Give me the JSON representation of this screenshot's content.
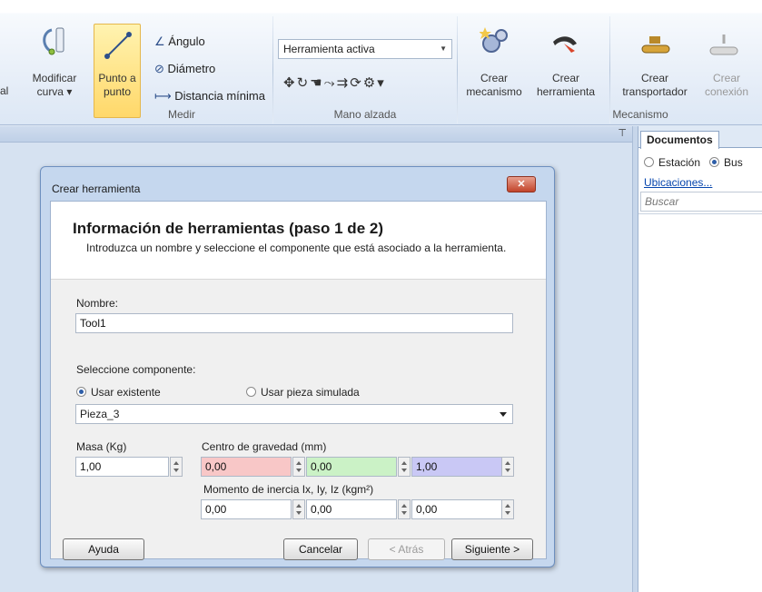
{
  "ribbon": {
    "cut_label": "al",
    "modificar_curva": [
      "Modificar",
      "curva ▾"
    ],
    "punto_a_punto": [
      "Punto a",
      "punto"
    ],
    "angulo": "Ángulo",
    "diametro": "Diámetro",
    "distancia_minima": "Distancia mínima",
    "medir_group": "Medir",
    "herramienta_activa": "Herramienta activa",
    "mano_alzada_group": "Mano alzada",
    "crear_mecanismo": [
      "Crear",
      "mecanismo"
    ],
    "crear_herramienta": [
      "Crear",
      "herramienta"
    ],
    "crear_transportador": [
      "Crear",
      "transportador"
    ],
    "crear_conexion": [
      "Crear",
      "conexión"
    ],
    "mecanismo_group": "Mecanismo"
  },
  "right_panel": {
    "tab": "Documentos",
    "radio_estacion": "Estación",
    "radio_buscar": "Bus",
    "ubicaciones_link": "Ubicaciones...",
    "search_placeholder": "Buscar"
  },
  "dialog": {
    "title": "Crear herramienta",
    "close": "✕",
    "heading": "Información de herramientas (paso 1 de 2)",
    "subtitle": "Introduzca un nombre y seleccione el componente que está asociado a la herramienta.",
    "nombre_label": "Nombre:",
    "nombre_value": "Tool1",
    "seleccione_label": "Seleccione componente:",
    "usar_existente": "Usar existente",
    "usar_pieza_simulada": "Usar pieza simulada",
    "componente_value": "Pieza_3",
    "masa_label": "Masa (Kg)",
    "masa_value": "1,00",
    "cog_label": "Centro de gravedad (mm)",
    "cog": [
      "0,00",
      "0,00",
      "1,00"
    ],
    "inercia_label": "Momento de inercia Ix, Iy, Iz (kgm²)",
    "inercia": [
      "0,00",
      "0,00",
      "0,00"
    ],
    "btn_ayuda": "Ayuda",
    "btn_cancelar": "Cancelar",
    "btn_atras": "< Atrás",
    "btn_siguiente": "Siguiente >"
  },
  "colors": {
    "accent": "#2e5ea8",
    "cog_x": "#f8c7c7",
    "cog_y": "#cbf2c6",
    "cog_z": "#c9c8f5"
  }
}
